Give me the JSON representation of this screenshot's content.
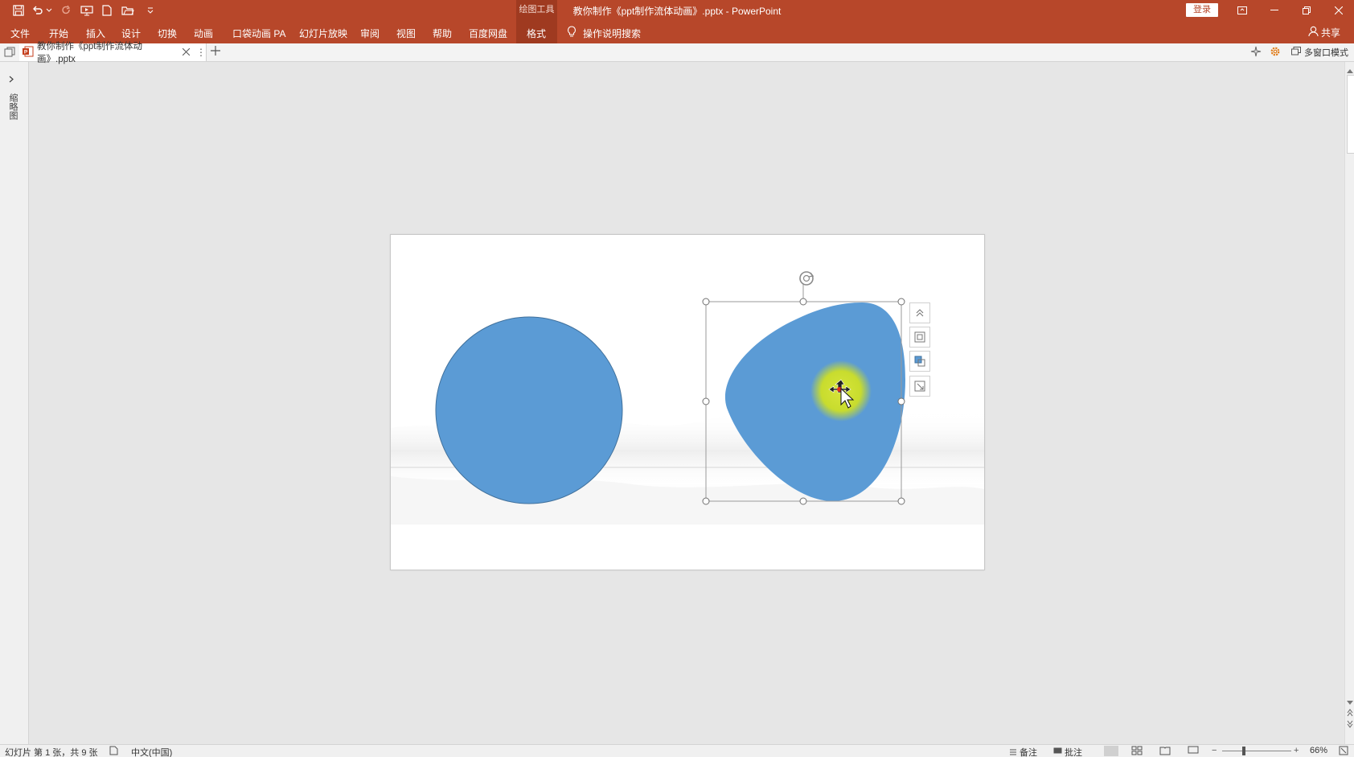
{
  "window": {
    "title": "教你制作《ppt制作流体动画》.pptx  -  PowerPoint",
    "context_tool_label": "绘图工具",
    "login_label": "登录"
  },
  "ribbon": {
    "tabs": [
      "文件",
      "开始",
      "插入",
      "设计",
      "切换",
      "动画",
      "口袋动画 PA",
      "幻灯片放映",
      "审阅",
      "视图",
      "帮助",
      "百度网盘",
      "格式"
    ],
    "active_tab": "格式",
    "tell_me": "操作说明搜索",
    "share": "共享"
  },
  "document_tab": {
    "name": "教你制作《ppt制作流体动画》.pptx",
    "multi_window": "多窗口模式"
  },
  "left_pane": {
    "label": "缩略图"
  },
  "slide": {
    "shape_fill": "#5b9bd5",
    "shape_stroke": "#41719c",
    "cursor_highlight": "#c8dc2e"
  },
  "status_bar": {
    "slide_info": "幻灯片 第 1 张，共 9 张",
    "language": "中文(中国)",
    "notes": "备注",
    "comments": "批注",
    "zoom": "66%"
  },
  "colors": {
    "accent": "#b7472a",
    "accent_dark": "#9f3a20"
  },
  "icons": [
    "save-icon",
    "undo-icon",
    "redo-icon",
    "present-icon",
    "new-icon",
    "open-icon",
    "customize-icon",
    "ribbon-display-icon",
    "minimize-icon",
    "restore-icon",
    "close-icon",
    "lightbulb-icon",
    "user-icon",
    "pptx-file-icon",
    "close-tab-icon",
    "more-icon",
    "add-tab-icon",
    "rotate-icon",
    "chevron-up-icon",
    "layout-options-icon",
    "arrange-icon",
    "format-icon"
  ]
}
